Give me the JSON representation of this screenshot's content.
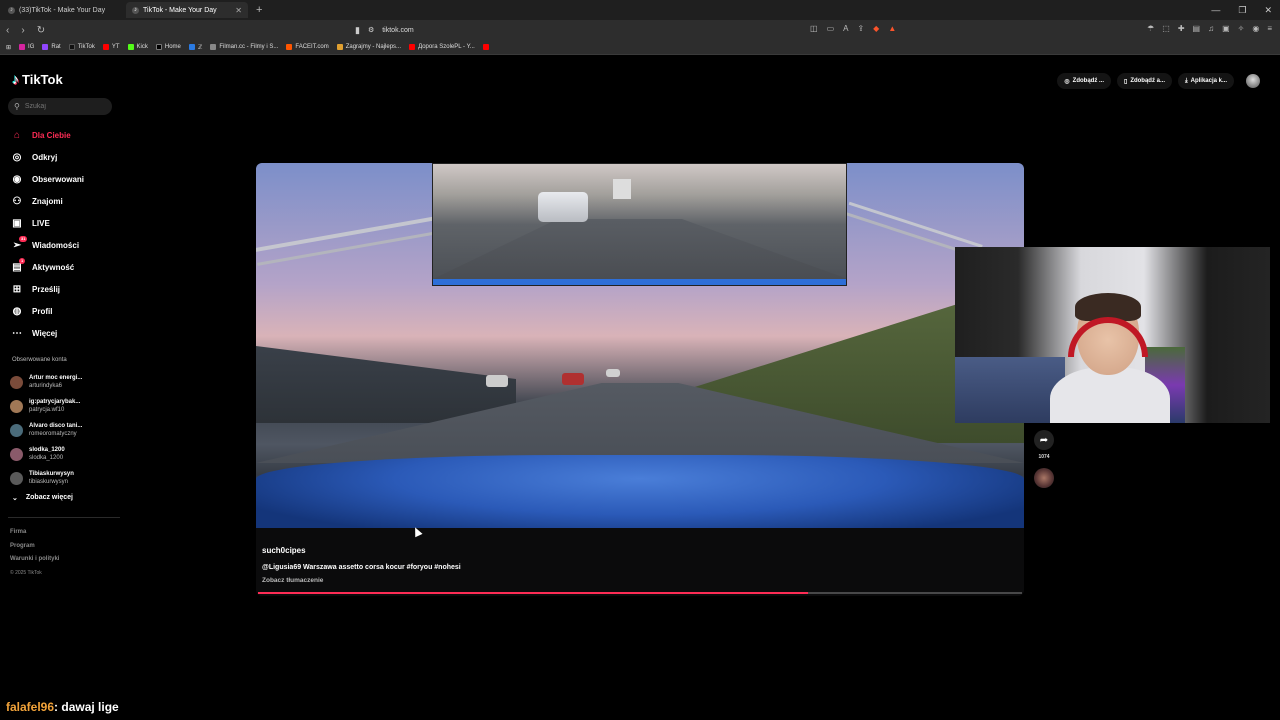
{
  "browser": {
    "tabs": [
      {
        "label": "(33)TikTok - Make Your Day",
        "active": false
      },
      {
        "label": "TikTok - Make Your Day",
        "active": true
      }
    ],
    "url": "tiktok.com",
    "bookmarks": [
      "IG",
      "Rat",
      "TikTok",
      "YT",
      "Kick",
      "Home",
      "ℤ",
      "Filman.cc - Filmy i S...",
      "FACEIT.com",
      "Zagrajmy - Najleps...",
      "Дорога SzolePL - Y..."
    ]
  },
  "tiktok": {
    "logo": "TikTok",
    "search_placeholder": "Szukaj",
    "nav": [
      {
        "label": "Dla Ciebie",
        "icon": "home-icon",
        "active": true
      },
      {
        "label": "Odkryj",
        "icon": "compass-icon"
      },
      {
        "label": "Obserwowani",
        "icon": "following-icon"
      },
      {
        "label": "Znajomi",
        "icon": "friends-icon"
      },
      {
        "label": "LIVE",
        "icon": "live-icon"
      },
      {
        "label": "Wiadomości",
        "icon": "messages-icon",
        "badge": "31"
      },
      {
        "label": "Aktywność",
        "icon": "activity-icon",
        "badge": "1"
      },
      {
        "label": "Prześlij",
        "icon": "upload-icon"
      },
      {
        "label": "Profil",
        "icon": "profile-icon"
      },
      {
        "label": "Więcej",
        "icon": "more-icon"
      }
    ],
    "followed_heading": "Obserwowane konta",
    "followed": [
      {
        "name": "Artur moc energi...",
        "user": "arturindyka6",
        "color": "#7a4b3a"
      },
      {
        "name": "ig:patrycjarybak...",
        "user": "patrycja.wf10",
        "color": "#a07856"
      },
      {
        "name": "Alvaro disco tani...",
        "user": "romeoromatyczny",
        "color": "#4a6b7a"
      },
      {
        "name": "slodka_1200",
        "user": "slodka_1200",
        "color": "#8a5a6a"
      },
      {
        "name": "Tibiaskurwysyn",
        "user": "tibiaskurwysyn",
        "color": "#5a5a5a"
      }
    ],
    "see_more": "Zobacz więcej",
    "footer": [
      "Firma",
      "Program",
      "Warunki i polityki"
    ],
    "copyright": "© 2025 TikTok",
    "top_right": [
      "Zdobądź ...",
      "Zdobądź a...",
      "Aplikacja k..."
    ],
    "video": {
      "username": "such0cipes",
      "description": "@Ligusia69 Warszawa assetto corsa kocur #foryou #nohesi",
      "translate": "Zobacz tłumaczenie",
      "progress": 0.72
    },
    "share_count": "1074"
  },
  "chat": {
    "user": "falafel96",
    "message": ": dawaj lige"
  }
}
